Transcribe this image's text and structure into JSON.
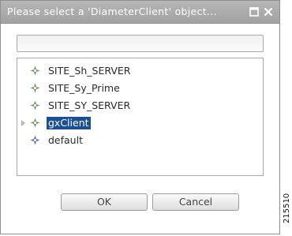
{
  "dialog": {
    "title": "Please select a 'DiameterClient' object...",
    "search": {
      "value": "",
      "placeholder": ""
    },
    "tree_items": [
      {
        "label": "SITE_Sh_SERVER",
        "icon": "diamond-node-icon",
        "color": "#6b8e5a"
      },
      {
        "label": "SITE_Sy_Prime",
        "icon": "diamond-node-icon",
        "color": "#6b8e5a"
      },
      {
        "label": "SITE_SY_SERVER",
        "icon": "diamond-node-icon",
        "color": "#6b8e5a"
      },
      {
        "label": "gxClient",
        "icon": "diamond-node-icon",
        "color": "#6b8e5a",
        "selected": true,
        "expandable": true
      },
      {
        "label": "default",
        "icon": "diamond-node-icon",
        "color": "#4a6fb0"
      }
    ],
    "buttons": {
      "ok": "OK",
      "cancel": "Cancel"
    }
  },
  "figure_id": "215510",
  "colors": {
    "titlebar": "#aaaaaa",
    "selection": "#1a4e96"
  }
}
